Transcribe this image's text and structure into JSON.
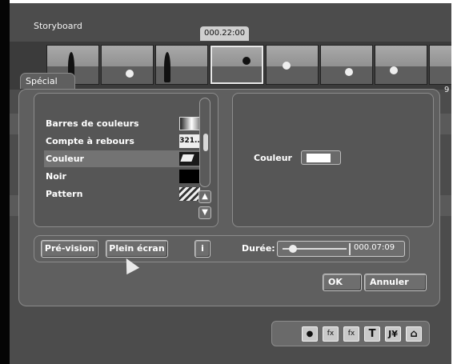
{
  "storyboard": {
    "label": "Storyboard",
    "timecode": "000.22:00",
    "side_number": "9"
  },
  "dialog": {
    "title": "Spécial",
    "items": [
      {
        "label": "Barres de couleurs",
        "swatch": "gradient",
        "swatch_text": ""
      },
      {
        "label": "Compte à rebours",
        "swatch": "countdown",
        "swatch_text": "321.."
      },
      {
        "label": "Couleur",
        "swatch": "color",
        "swatch_text": ""
      },
      {
        "label": "Noir",
        "swatch": "black",
        "swatch_text": ""
      },
      {
        "label": "Pattern",
        "swatch": "pattern",
        "swatch_text": ""
      }
    ],
    "selected_item": "Couleur",
    "scroll_up_icon": "chevron-up-icon",
    "scroll_down_icon": "chevron-down-icon",
    "color_label": "Couleur",
    "color_value": "#ffffff",
    "preview_button": "Pré-vision",
    "fullscreen_button": "Plein écran",
    "info_button": "i",
    "duration_label": "Durée:",
    "duration_value": "000.07:09",
    "ok_button": "OK",
    "cancel_button": "Annuler"
  },
  "toolbar": {
    "icons": [
      {
        "name": "camera-icon",
        "glyph": "●"
      },
      {
        "name": "fx-icon",
        "glyph": "fx"
      },
      {
        "name": "fx-transition-icon",
        "glyph": "fx"
      },
      {
        "name": "title-icon",
        "glyph": "T"
      },
      {
        "name": "tools-icon",
        "glyph": "J¥"
      },
      {
        "name": "home-icon",
        "glyph": "⌂"
      }
    ]
  }
}
